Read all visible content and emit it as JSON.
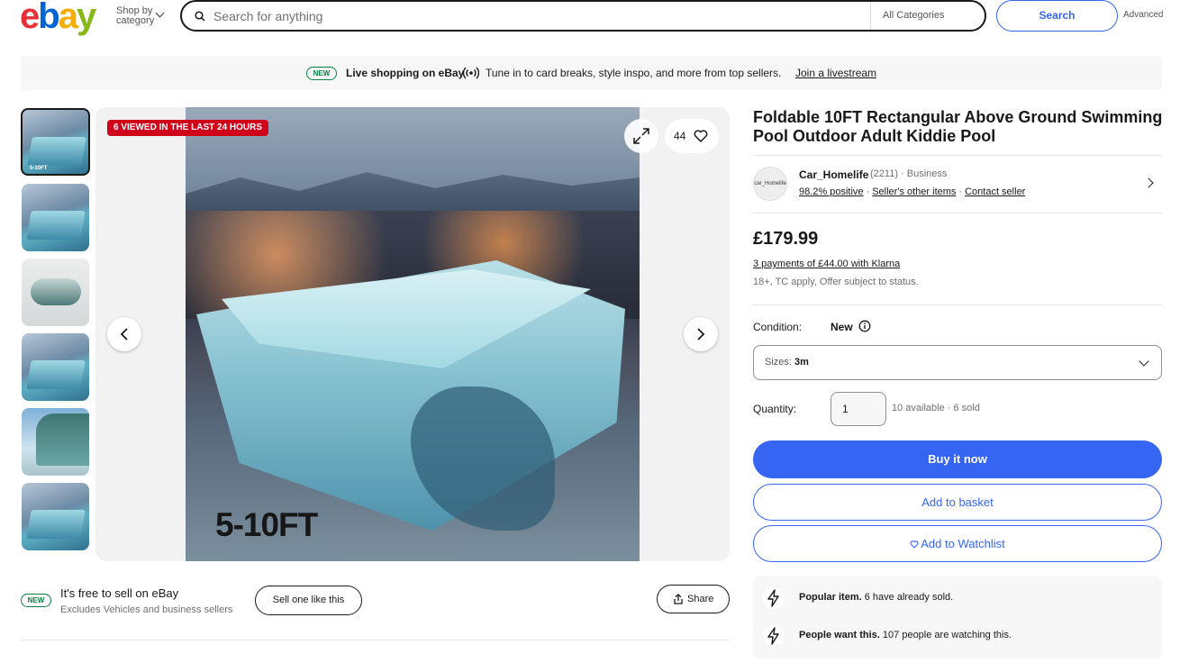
{
  "header": {
    "logo_letters": [
      "e",
      "b",
      "a",
      "y"
    ],
    "shop_by_line1": "Shop by",
    "shop_by_line2": "category",
    "search_placeholder": "Search for anything",
    "category_select": "All Categories",
    "search_button": "Search",
    "advanced_link": "Advanced"
  },
  "banner": {
    "badge": "NEW",
    "bold_text": "Live shopping on eBay",
    "text": "Tune in to card breaks, style inspo, and more from top sellers.",
    "link": "Join a livestream"
  },
  "gallery": {
    "thumbnails": [
      {
        "label": "5-10FT",
        "selected": true
      },
      {
        "label": "",
        "selected": false
      },
      {
        "label": "",
        "selected": false
      },
      {
        "label": "",
        "selected": false
      },
      {
        "label": "",
        "selected": false
      },
      {
        "label": "",
        "selected": false
      }
    ],
    "viewed_badge": "6 VIEWED IN THE LAST 24 HOURS",
    "watch_count": "44",
    "image_caption": "5-10FT"
  },
  "sell": {
    "badge": "NEW",
    "title": "It's free to sell on eBay",
    "subtitle": "Excludes Vehicles and business sellers",
    "sell_button": "Sell one like this",
    "share_button": "Share"
  },
  "item": {
    "title": "Foldable 10FT Rectangular Above Ground Swimming Pool Outdoor Adult Kiddie Pool",
    "seller": {
      "avatar_text": "car_Homelife",
      "name": "Car_Homelife",
      "meta": "(2211) · Business",
      "positive": "98.2% positive",
      "other_items": "Seller's other items",
      "contact": "Contact seller"
    },
    "price": "£179.99",
    "klarna": "3 payments of £44.00 with Klarna",
    "klarna_note": "18+, TC apply, Offer subject to status.",
    "condition_label": "Condition:",
    "condition_value": "New",
    "size_label": "Sizes:",
    "size_value": "3m",
    "quantity_label": "Quantity:",
    "quantity_value": "1",
    "availability": "10 available · 6 sold",
    "buy_now": "Buy it now",
    "add_to_basket": "Add to basket",
    "add_to_watchlist": "Add to Watchlist",
    "signals": [
      {
        "bold": "Popular item.",
        "text": "6 have already sold."
      },
      {
        "bold": "People want this.",
        "text": "107 people are watching this."
      }
    ]
  },
  "colors": {
    "accent": "#3665f3",
    "badge_green": "#05823f",
    "badge_red": "#d0021b",
    "logo_e": "#e53238",
    "logo_b": "#0064d2",
    "logo_a": "#f5af02",
    "logo_y": "#86b817"
  },
  "icons": [
    "search-icon",
    "chevron-down-icon",
    "live-broadcast-icon",
    "expand-icon",
    "heart-icon",
    "chevron-left-icon",
    "chevron-right-icon",
    "share-icon",
    "info-icon",
    "lightning-icon"
  ]
}
